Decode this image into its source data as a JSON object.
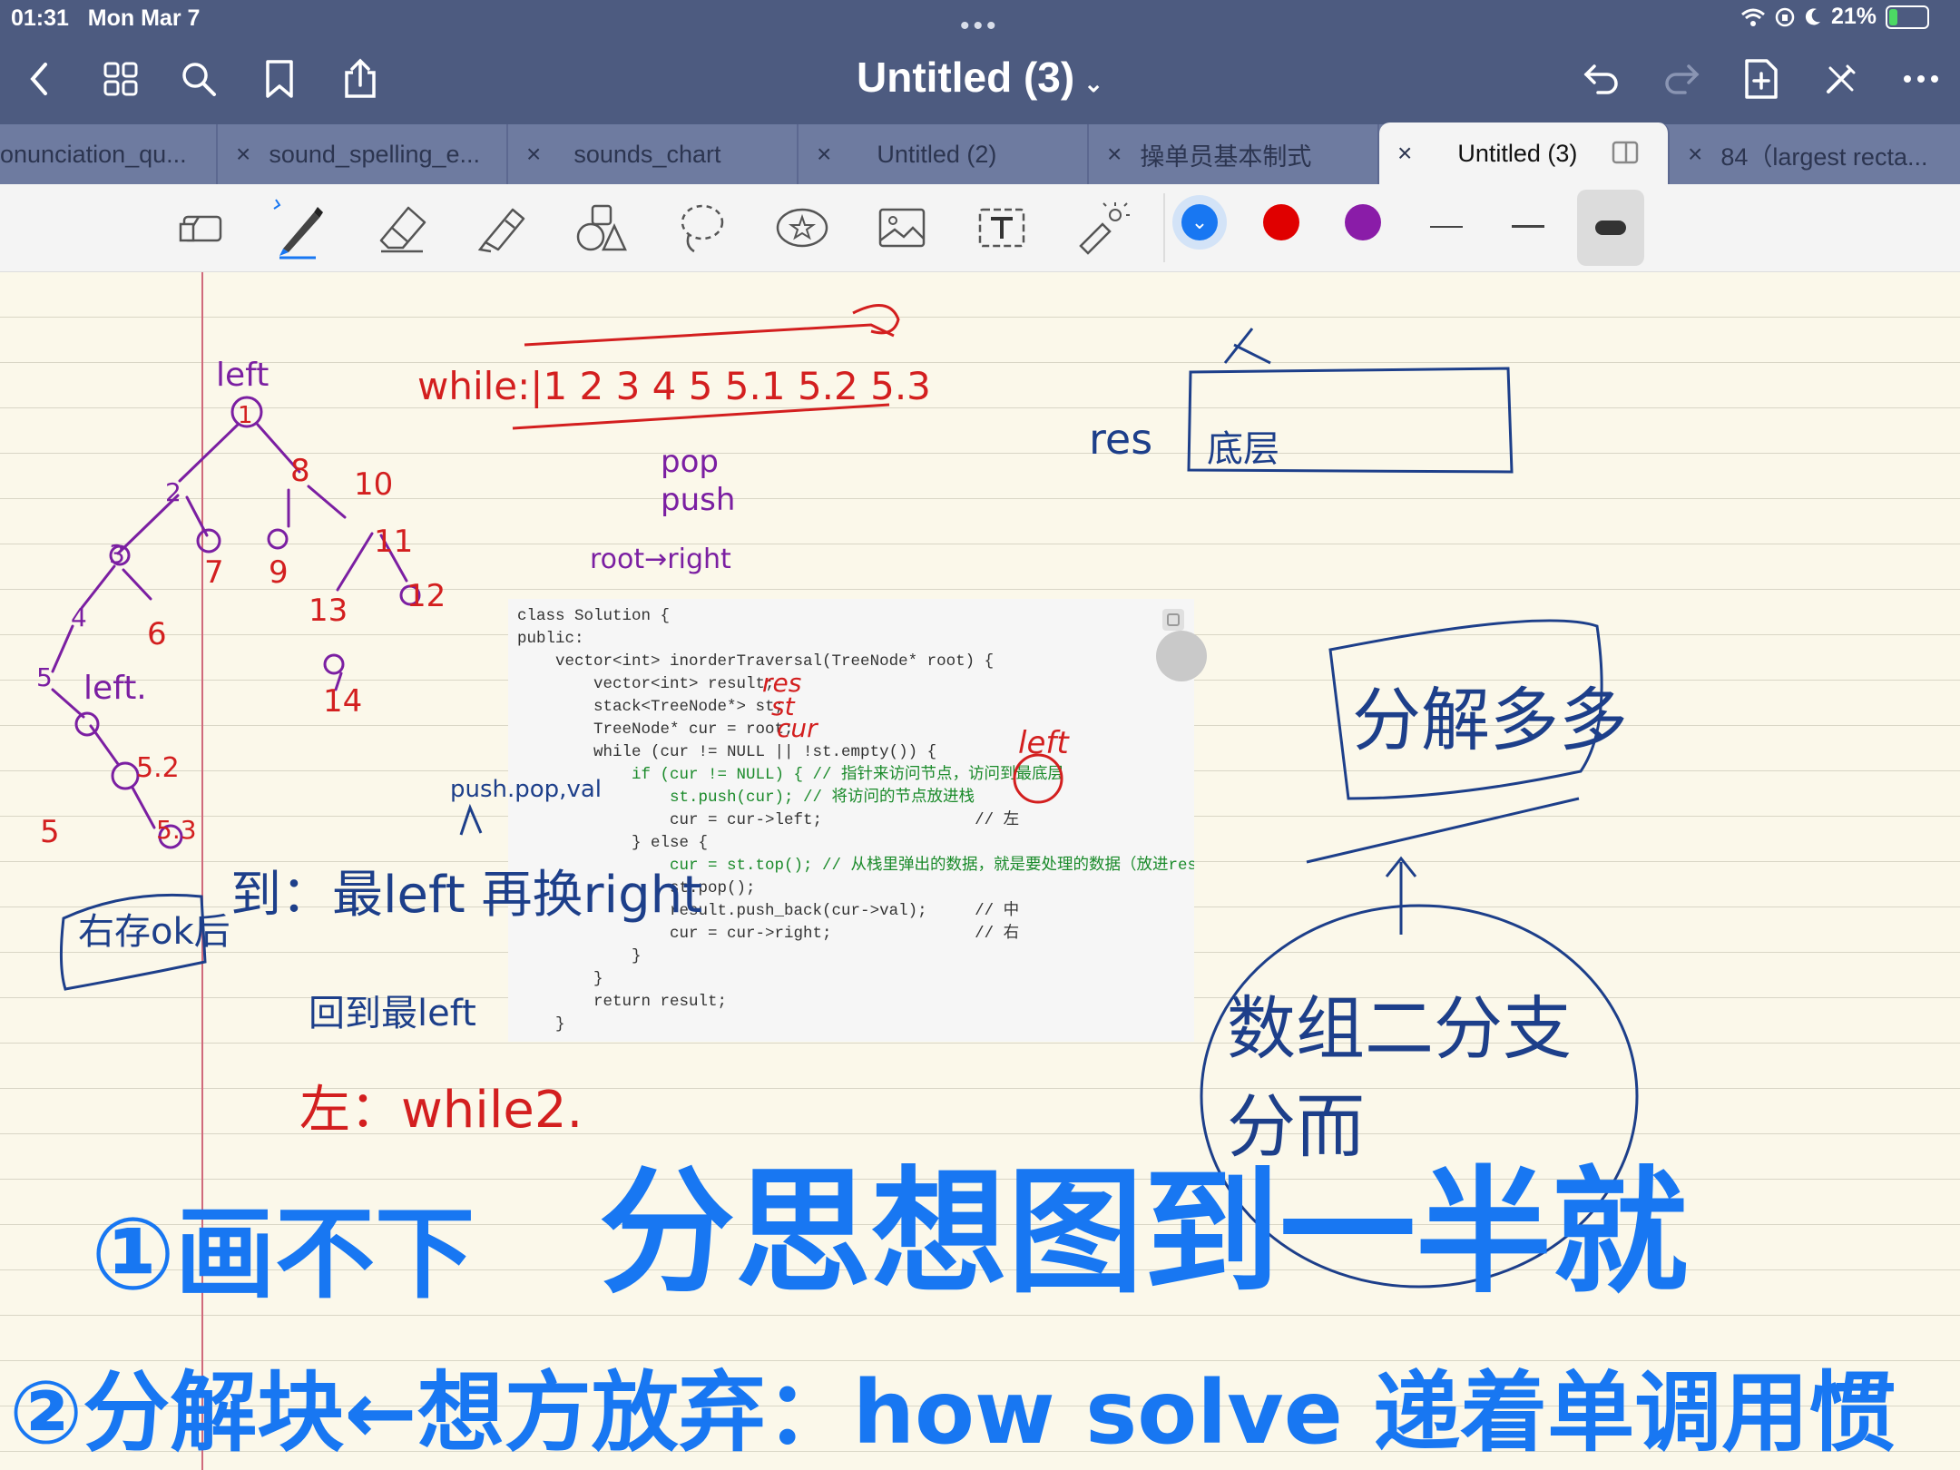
{
  "status": {
    "time": "01:31",
    "date": "Mon Mar 7",
    "battery": "21%"
  },
  "header": {
    "title": "Untitled (3)"
  },
  "tabs": [
    {
      "label": "onunciation_qu..."
    },
    {
      "label": "sound_spelling_e..."
    },
    {
      "label": "sounds_chart"
    },
    {
      "label": "Untitled (2)"
    },
    {
      "label": "操单员基本制式"
    },
    {
      "label": "Untitled (3)",
      "active": true
    },
    {
      "label": "84（largest recta..."
    }
  ],
  "toolbar": {
    "tools": [
      "ruler-icon",
      "pen-icon",
      "eraser-icon",
      "highlighter-icon",
      "shapes-icon",
      "lasso-icon",
      "sticker-icon",
      "image-icon",
      "text-icon",
      "laser-icon"
    ],
    "colors": [
      "#1877f2",
      "#e00000",
      "#8a1ca8"
    ]
  },
  "code": {
    "lines": [
      "class Solution {",
      "public:",
      "    vector<int> inorderTraversal(TreeNode* root) {",
      "        vector<int> result;",
      "        stack<TreeNode*> st;",
      "        TreeNode* cur = root;",
      "        while (cur != NULL || !st.empty()) {",
      "            if (cur != NULL) { // 指针来访问节点，访问到最底层",
      "                st.push(cur); // 将访问的节点放进栈",
      "                cur = cur->left;                // 左",
      "            } else {",
      "                cur = st.top(); // 从栈里弹出的数据，就是要处理的数据（放进resu",
      "                st.pop();",
      "                result.push_back(cur->val);     // 中",
      "                cur = cur->right;               // 右",
      "            }",
      "        }",
      "        return result;",
      "    }"
    ]
  },
  "handwriting": {
    "left_top": "left",
    "left_mid": "left.",
    "while_row": "while:|1 2 3 4 5 5.1 5.2 5.3",
    "pop": "pop",
    "push": "push",
    "root_right": "root→right",
    "res": "res",
    "res_box": "底层",
    "push_pop_val": "push.pop,val",
    "res_note": "res",
    "st_note": "st",
    "cur_note": "cur",
    "left_code": "left",
    "summary": "到：最left 再换right",
    "back_left": "回到最left",
    "left_box": "右存ok后",
    "left_while": "左：while2.",
    "big1": "①画不下",
    "big2": "分思想图到一半就",
    "big3": "②分解块←想方放弃：how solve 递着单调用惯",
    "right_circle_top": "数组二分支",
    "right_circle_bottom": "分而",
    "right_box": "分解多多"
  }
}
